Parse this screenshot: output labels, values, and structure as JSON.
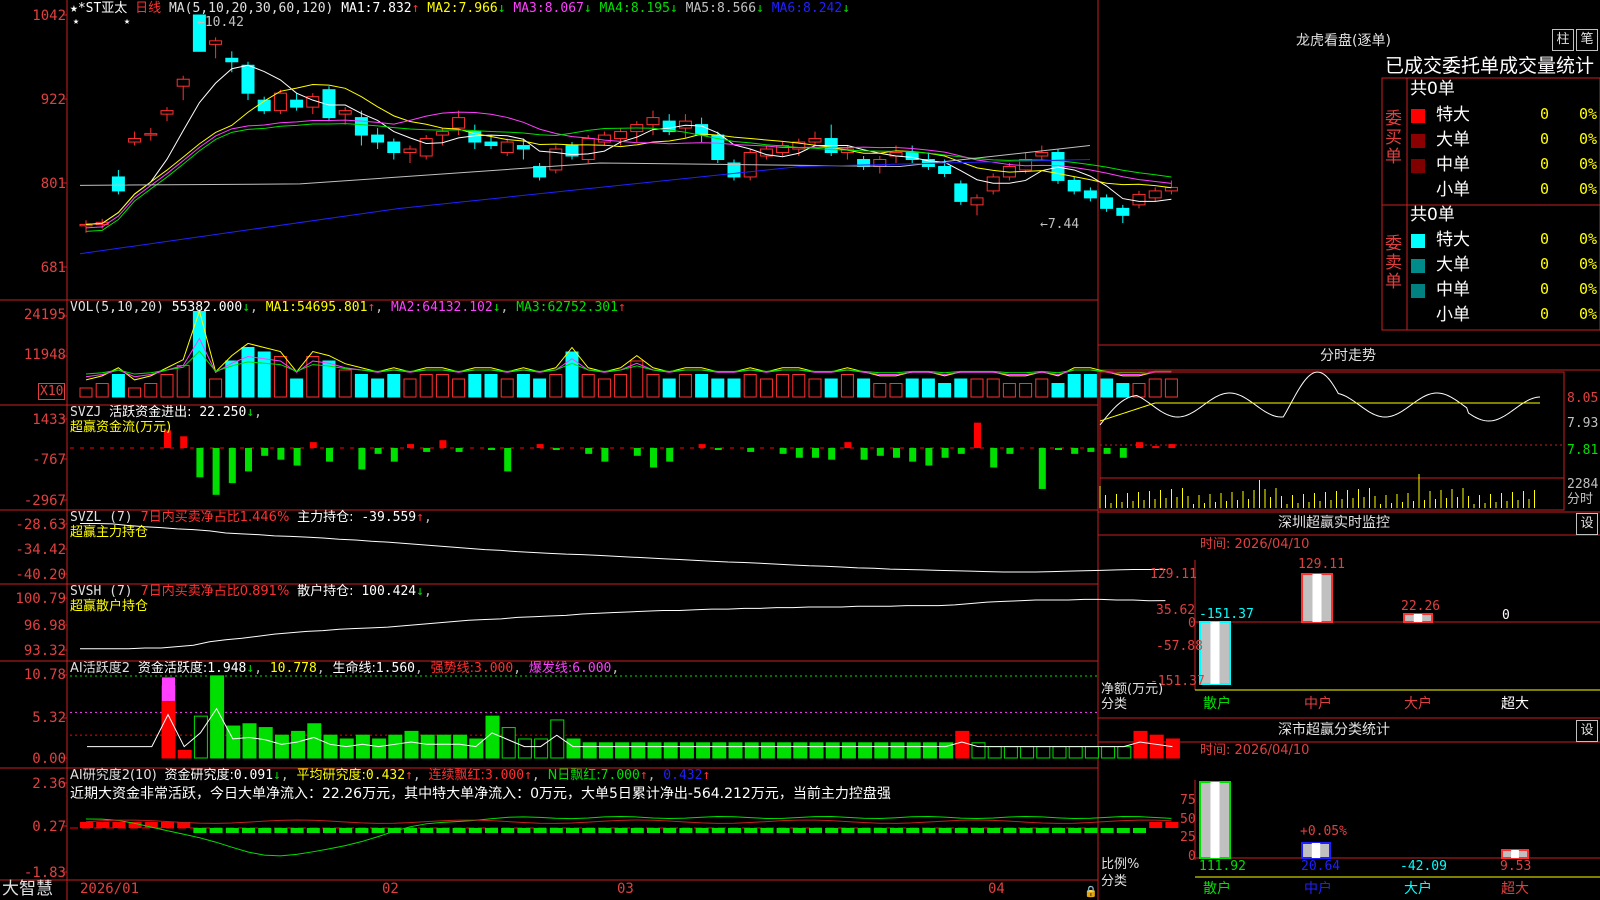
{
  "colors": {
    "up": "#ff3030",
    "down": "#00ffff",
    "axis": "#c82020",
    "ma1": "#ffffff",
    "ma2": "#ffff00",
    "ma3": "#ff40ff",
    "ma4": "#00e000",
    "ma5": "#c0c0c0",
    "ma6": "#2020ff",
    "green": "#00e000",
    "red": "#ff0000",
    "cyan": "#00ffff",
    "yellow": "#ffff00",
    "magenta": "#ff40ff"
  },
  "main": {
    "stock_name": "*ST亚太",
    "period": "日线",
    "ma_params": "MA(5,10,20,30,60,120)",
    "ma_values": [
      {
        "name": "MA1:",
        "value": "7.832",
        "arrow": "↑"
      },
      {
        "name": "MA2:",
        "value": "7.966",
        "arrow": "↓"
      },
      {
        "name": "MA3:",
        "value": "8.067",
        "arrow": "↓"
      },
      {
        "name": "MA4:",
        "value": "8.195",
        "arrow": "↓"
      },
      {
        "name": "MA5:",
        "value": "8.566",
        "arrow": "↓"
      },
      {
        "name": "MA6:",
        "value": "8.242",
        "arrow": "↓"
      }
    ],
    "y_labels": [
      "1042",
      "922",
      "801",
      "681"
    ],
    "high_label": "10.42",
    "low_label": "7.44",
    "candles": [
      [
        7.4,
        7.48,
        7.3,
        7.42
      ],
      [
        7.42,
        7.5,
        7.36,
        7.45
      ],
      [
        8.1,
        8.2,
        7.85,
        7.9
      ],
      [
        8.6,
        8.75,
        8.55,
        8.65
      ],
      [
        8.7,
        8.8,
        8.62,
        8.72
      ],
      [
        9.0,
        9.1,
        8.9,
        9.05
      ],
      [
        9.4,
        9.55,
        9.2,
        9.5
      ],
      [
        10.42,
        10.42,
        10.0,
        9.9
      ],
      [
        10.0,
        10.1,
        9.8,
        10.05
      ],
      [
        9.8,
        9.9,
        9.6,
        9.75
      ],
      [
        9.7,
        9.75,
        9.2,
        9.3
      ],
      [
        9.2,
        9.25,
        9.0,
        9.05
      ],
      [
        9.05,
        9.35,
        9.0,
        9.3
      ],
      [
        9.2,
        9.3,
        9.05,
        9.1
      ],
      [
        9.1,
        9.3,
        9.0,
        9.25
      ],
      [
        9.35,
        9.4,
        8.9,
        8.95
      ],
      [
        9.0,
        9.1,
        8.85,
        9.05
      ],
      [
        8.95,
        9.05,
        8.55,
        8.7
      ],
      [
        8.7,
        8.8,
        8.5,
        8.6
      ],
      [
        8.6,
        8.65,
        8.35,
        8.45
      ],
      [
        8.45,
        8.55,
        8.3,
        8.5
      ],
      [
        8.4,
        8.7,
        8.35,
        8.65
      ],
      [
        8.7,
        8.8,
        8.55,
        8.75
      ],
      [
        8.8,
        9.05,
        8.7,
        8.95
      ],
      [
        8.75,
        8.85,
        8.5,
        8.6
      ],
      [
        8.6,
        8.7,
        8.5,
        8.55
      ],
      [
        8.45,
        8.65,
        8.4,
        8.6
      ],
      [
        8.55,
        8.65,
        8.35,
        8.5
      ],
      [
        8.25,
        8.3,
        8.05,
        8.1
      ],
      [
        8.2,
        8.55,
        8.15,
        8.5
      ],
      [
        8.55,
        8.6,
        8.35,
        8.4
      ],
      [
        8.35,
        8.7,
        8.3,
        8.65
      ],
      [
        8.6,
        8.75,
        8.55,
        8.7
      ],
      [
        8.65,
        8.8,
        8.55,
        8.75
      ],
      [
        8.75,
        8.9,
        8.6,
        8.85
      ],
      [
        8.85,
        9.05,
        8.7,
        8.95
      ],
      [
        8.9,
        9.0,
        8.7,
        8.75
      ],
      [
        8.8,
        9.0,
        8.65,
        8.9
      ],
      [
        8.85,
        8.95,
        8.6,
        8.7
      ],
      [
        8.7,
        8.75,
        8.3,
        8.35
      ],
      [
        8.3,
        8.35,
        8.05,
        8.1
      ],
      [
        8.1,
        8.5,
        8.05,
        8.45
      ],
      [
        8.4,
        8.55,
        8.35,
        8.5
      ],
      [
        8.45,
        8.6,
        8.4,
        8.55
      ],
      [
        8.5,
        8.65,
        8.4,
        8.6
      ],
      [
        8.6,
        8.75,
        8.55,
        8.65
      ],
      [
        8.65,
        8.85,
        8.4,
        8.45
      ],
      [
        8.45,
        8.55,
        8.35,
        8.5
      ],
      [
        8.35,
        8.4,
        8.2,
        8.25
      ],
      [
        8.25,
        8.4,
        8.15,
        8.35
      ],
      [
        8.4,
        8.55,
        8.3,
        8.45
      ],
      [
        8.45,
        8.55,
        8.3,
        8.35
      ],
      [
        8.35,
        8.45,
        8.2,
        8.25
      ],
      [
        8.25,
        8.35,
        8.1,
        8.15
      ],
      [
        8.0,
        8.05,
        7.7,
        7.75
      ],
      [
        7.7,
        7.85,
        7.55,
        7.8
      ],
      [
        7.9,
        8.15,
        7.85,
        8.1
      ],
      [
        8.1,
        8.3,
        8.05,
        8.25
      ],
      [
        8.2,
        8.45,
        8.15,
        8.35
      ],
      [
        8.4,
        8.55,
        8.35,
        8.45
      ],
      [
        8.45,
        8.5,
        8.0,
        8.05
      ],
      [
        8.05,
        8.1,
        7.85,
        7.9
      ],
      [
        7.9,
        7.95,
        7.75,
        7.8
      ],
      [
        7.8,
        7.85,
        7.6,
        7.65
      ],
      [
        7.65,
        7.7,
        7.44,
        7.55
      ],
      [
        7.7,
        7.9,
        7.65,
        7.85
      ],
      [
        7.8,
        7.95,
        7.75,
        7.9
      ],
      [
        7.9,
        8.05,
        7.85,
        7.95
      ]
    ]
  },
  "vol": {
    "header": "VOL(5,10,20)",
    "value": "55382.000",
    "ma": [
      {
        "name": "MA1:",
        "value": "54695.801",
        "arrow": "↑"
      },
      {
        "name": "MA2:",
        "value": "64132.102",
        "arrow": "↓"
      },
      {
        "name": "MA3:",
        "value": "62752.301",
        "arrow": "↑"
      }
    ],
    "y_labels": [
      "24195",
      "11948"
    ],
    "unit": "X10",
    "bars": [
      2,
      3,
      5,
      2,
      3,
      5,
      7,
      19,
      4,
      8,
      11,
      10,
      9,
      4,
      9,
      8,
      6,
      5,
      4,
      5,
      4,
      5,
      5,
      4,
      5,
      5,
      4,
      5,
      4,
      5,
      10,
      5,
      4,
      5,
      8,
      5,
      4,
      5,
      5,
      4,
      4,
      5,
      4,
      5,
      5,
      4,
      4,
      5,
      4,
      3,
      3,
      4,
      4,
      3,
      4,
      4,
      4,
      3,
      3,
      4,
      3,
      5,
      5,
      4,
      3,
      3,
      4,
      4
    ]
  },
  "svzj": {
    "header": "SVZJ",
    "label1": "活跃资金进出:",
    "value1": "22.250",
    "arrow1": "↓",
    "label2": "超赢资金流(万元)",
    "y_labels": [
      "1433",
      "-767",
      "-2967"
    ],
    "bars": [
      0,
      0,
      0,
      0,
      0,
      900,
      600,
      -1500,
      -2400,
      -1800,
      -1200,
      -400,
      -600,
      -900,
      300,
      -700,
      0,
      -1100,
      -300,
      -700,
      200,
      -200,
      400,
      -200,
      0,
      -100,
      -1200,
      0,
      200,
      -100,
      0,
      -300,
      -700,
      0,
      -400,
      -1000,
      -700,
      0,
      200,
      -100,
      0,
      -200,
      0,
      -300,
      -500,
      -500,
      -600,
      300,
      -600,
      -400,
      -500,
      -700,
      -900,
      -500,
      -300,
      1300,
      -1000,
      -300,
      0,
      -2100,
      -100,
      -300,
      -200,
      -300,
      -500,
      300,
      100,
      200
    ]
  },
  "svzl": {
    "header": "SVZL (7)",
    "label1": "7日内买卖净占比1.446%",
    "label2": "主力持仓:",
    "value2": "-39.559",
    "arrow2": "↑",
    "sub": "超赢主力持仓",
    "y_labels": [
      "-28.63",
      "-34.42",
      "-40.20"
    ],
    "line": [
      -28.5,
      -28.5,
      -28.6,
      -29.0,
      -29.3,
      -29.5,
      -29.8,
      -30.0,
      -30.3,
      -30.8,
      -31.0,
      -31.2,
      -31.5,
      -31.6,
      -31.8,
      -32.0,
      -32.3,
      -32.5,
      -32.8,
      -33.0,
      -33.3,
      -33.6,
      -33.9,
      -34.2,
      -34.5,
      -34.8,
      -35.0,
      -35.3,
      -35.5,
      -35.7,
      -35.9,
      -36.0,
      -36.2,
      -36.4,
      -36.6,
      -36.8,
      -37.0,
      -37.2,
      -37.4,
      -37.6,
      -37.8,
      -37.9,
      -38.1,
      -38.3,
      -38.5,
      -38.7,
      -38.8,
      -39.0,
      -39.2,
      -39.3,
      -39.5,
      -39.6,
      -39.7,
      -39.8,
      -39.9,
      -40.0,
      -40.1,
      -40.2,
      -40.2,
      -40.2,
      -40.1,
      -40.0,
      -39.9,
      -39.8,
      -39.7,
      -39.6,
      -39.6,
      -39.56
    ]
  },
  "svsh": {
    "header": "SVSH (7)",
    "label1": "7日内买卖净占比0.891%",
    "label2": "散户持仓:",
    "value2": "100.424",
    "arrow2": "↓",
    "sub": "超赢散户持仓",
    "y_labels": [
      "100.79",
      "96.98",
      "93.32"
    ],
    "line": [
      93.5,
      93.5,
      93.5,
      93.5,
      93.6,
      93.6,
      93.8,
      94.0,
      94.5,
      94.8,
      95.0,
      95.3,
      95.6,
      95.8,
      96.0,
      96.1,
      96.3,
      96.4,
      96.5,
      96.6,
      96.8,
      97.0,
      97.2,
      97.4,
      97.6,
      97.7,
      97.8,
      98.0,
      98.1,
      98.2,
      98.3,
      98.5,
      98.6,
      98.7,
      98.8,
      98.9,
      99.0,
      99.0,
      99.1,
      99.2,
      99.2,
      99.3,
      99.3,
      99.4,
      99.4,
      99.5,
      99.5,
      99.5,
      99.6,
      99.6,
      99.6,
      99.7,
      99.7,
      99.7,
      99.8,
      100.0,
      100.2,
      100.3,
      100.4,
      100.5,
      100.5,
      100.5,
      100.6,
      100.6,
      100.5,
      100.5,
      100.4,
      100.42
    ]
  },
  "ai_activity": {
    "header": "AI活跃度2",
    "label1": "资金活跃度:",
    "value1": "1.948",
    "arrow1": "↓",
    "value2": "10.778",
    "label3": "生命线:",
    "value3": "1.560",
    "label4": "强势线:",
    "value4": "3.000",
    "label5": "爆发线:",
    "value5": "6.000",
    "y_labels": [
      "10.78",
      "5.32",
      "0.00"
    ],
    "bars": [
      0,
      0,
      0,
      0,
      0,
      9.5,
      1,
      5.5,
      10.8,
      4.2,
      4.5,
      4.0,
      3.0,
      3.5,
      4.5,
      3.0,
      2.5,
      3.0,
      2.5,
      3.0,
      3.5,
      3.0,
      3.0,
      3.0,
      2.5,
      5.5,
      4.0,
      2.5,
      2.5,
      5.0,
      2.5,
      2.0,
      2.0,
      2.0,
      2.0,
      2.0,
      2.0,
      2.0,
      2.0,
      2.0,
      2.0,
      2.0,
      2.0,
      2.0,
      2.0,
      2.0,
      2.0,
      2.0,
      2.0,
      2.0,
      2.0,
      2.0,
      2.0,
      2.0,
      3.5,
      2.0,
      1.5,
      1.5,
      1.5,
      1.5,
      1.5,
      1.5,
      1.5,
      1.5,
      1.5,
      3.5,
      3.0,
      2.5
    ]
  },
  "ai_research": {
    "header": "AI研究度2(10)",
    "label1": "资金研究度:",
    "value1": "0.091",
    "arrow1": "↓",
    "label2": "平均研究度:",
    "value2": "0.432",
    "arrow2": "↑",
    "label3": "连续飘红:",
    "value3": "3.000",
    "arrow3": "↑",
    "label4": "N日飘红:",
    "value4": "7.000",
    "arrow4": "↑",
    "value5": "0.432",
    "arrow5": "↑",
    "comment": "近期大资金非常活跃，今日大单净流入：22.26万元，其中特大单净流入：0万元，大单5日累计净出-564.212万元，当前主力控盘强",
    "y_labels": [
      "2.36",
      "0.27",
      "-1.83"
    ]
  },
  "x_axis": {
    "labels": [
      "2026/01",
      "02",
      "03",
      "04"
    ]
  },
  "brand": "大智慧",
  "longhu": {
    "title": "龙虎看盘(逐单)",
    "btn1": "柱",
    "btn2": "笔",
    "table_title": "已成交委托单成交量统计",
    "buy_label": "委买单",
    "sell_label": "委卖单",
    "buy_total": "共0单",
    "sell_total": "共0单",
    "rows": [
      {
        "name": "特大",
        "val": "0",
        "pct": "0%"
      },
      {
        "name": "大单",
        "val": "0",
        "pct": "0%"
      },
      {
        "name": "中单",
        "val": "0",
        "pct": "0%"
      },
      {
        "name": "小单",
        "val": "0",
        "pct": "0%"
      }
    ],
    "buy_colors": [
      "#ff0000",
      "#8b0000",
      "#800000",
      "#000000"
    ],
    "sell_colors": [
      "#00ffff",
      "#008b8b",
      "#008080",
      "#000000"
    ]
  },
  "fenshi": {
    "title": "分时走势",
    "y_labels": [
      "8.05",
      "7.93",
      "7.81"
    ],
    "vol_label": "2284",
    "vol_unit": "分时"
  },
  "sz_monitor": {
    "title": "深圳超赢实时监控",
    "btn": "设",
    "date_label": "时间: 2026/04/10",
    "y_labels": [
      "129.11",
      "35.62",
      "0",
      "-57.88",
      "-151.37"
    ],
    "unit_label": "净额(万元)",
    "cat_label": "分类",
    "categories": [
      "散户",
      "中户",
      "大户",
      "超大"
    ],
    "values": [
      "-151.37",
      "129.11",
      "22.26",
      "0"
    ]
  },
  "sz_class": {
    "title": "深市超赢分类统计",
    "btn": "设",
    "date_label": "时间: 2026/04/10",
    "y_labels": [
      "75",
      "50",
      "25",
      "0"
    ],
    "unit_label": "比例%",
    "cat_label": "分类",
    "categories": [
      "散户",
      "中户",
      "大户",
      "超大"
    ],
    "values": [
      "111.92",
      "20.64",
      "-42.09",
      "9.53"
    ],
    "pct_label": "+0.05%"
  }
}
